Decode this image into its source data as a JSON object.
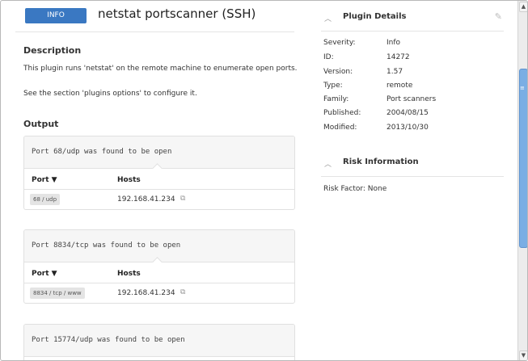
{
  "header": {
    "badge": "INFO",
    "title": "netstat portscanner (SSH)"
  },
  "description": {
    "heading": "Description",
    "text": "This plugin runs 'netstat' on the remote machine to enumerate open ports.",
    "see_also": "See the section 'plugins options' to configure it."
  },
  "output": {
    "heading": "Output",
    "col_port": "Port ▼",
    "col_hosts": "Hosts",
    "blocks": [
      {
        "message": "Port 68/udp was found to be open",
        "port": "68 / udp",
        "host": "192.168.41.234"
      },
      {
        "message": "Port 8834/tcp was found to be open",
        "port": "8834 / tcp / www",
        "host": "192.168.41.234"
      },
      {
        "message": "Port 15774/udp was found to be open"
      }
    ]
  },
  "plugin_details": {
    "heading": "Plugin Details",
    "rows": [
      {
        "key": "Severity:",
        "value": "Info"
      },
      {
        "key": "ID:",
        "value": "14272"
      },
      {
        "key": "Version:",
        "value": "1.57"
      },
      {
        "key": "Type:",
        "value": "remote"
      },
      {
        "key": "Family:",
        "value": "Port scanners"
      },
      {
        "key": "Published:",
        "value": "2004/08/15"
      },
      {
        "key": "Modified:",
        "value": "2013/10/30"
      }
    ]
  },
  "risk_information": {
    "heading": "Risk Information",
    "risk_factor": "Risk Factor:  None"
  },
  "icons": {
    "collapse": "chevron-up-icon",
    "edit": "pencil-icon",
    "external": "external-link-icon"
  }
}
